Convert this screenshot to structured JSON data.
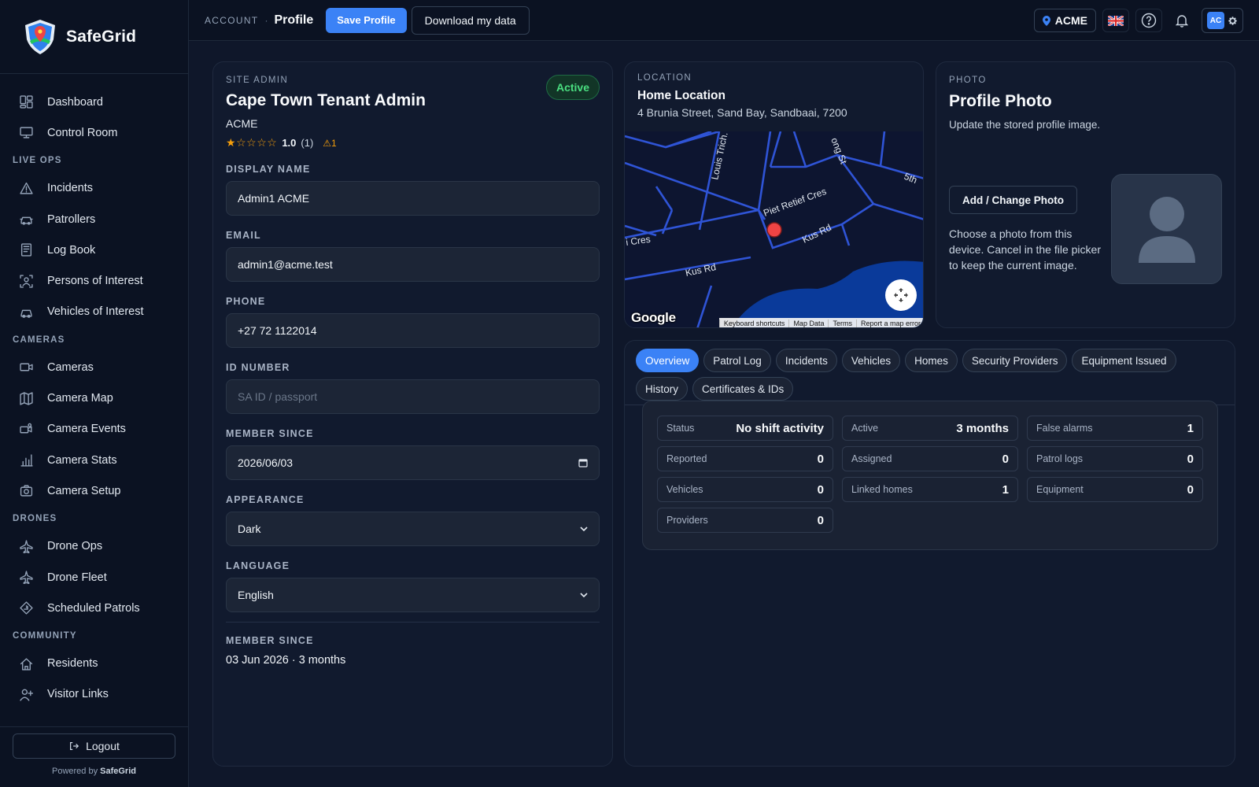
{
  "app": {
    "name": "SafeGrid",
    "powered_prefix": "Powered by",
    "powered_brand": "SafeGrid",
    "logout": "Logout"
  },
  "sidebar": {
    "top": [
      {
        "label": "Dashboard",
        "icon": "dashboard-icon"
      },
      {
        "label": "Control Room",
        "icon": "monitor-icon"
      }
    ],
    "sections": [
      {
        "title": "LIVE OPS",
        "items": [
          {
            "label": "Incidents",
            "icon": "warning-icon"
          },
          {
            "label": "Patrollers",
            "icon": "car-icon"
          },
          {
            "label": "Log Book",
            "icon": "logbook-icon"
          },
          {
            "label": "Persons of Interest",
            "icon": "person-scan-icon"
          },
          {
            "label": "Vehicles of Interest",
            "icon": "vehicle-icon"
          }
        ]
      },
      {
        "title": "CAMERAS",
        "items": [
          {
            "label": "Cameras",
            "icon": "camera-icon"
          },
          {
            "label": "Camera Map",
            "icon": "map-icon"
          },
          {
            "label": "Camera Events",
            "icon": "camera-events-icon"
          },
          {
            "label": "Camera Stats",
            "icon": "bar-chart-icon"
          },
          {
            "label": "Camera Setup",
            "icon": "camera-setup-icon"
          }
        ]
      },
      {
        "title": "DRONES",
        "items": [
          {
            "label": "Drone Ops",
            "icon": "plane-icon"
          },
          {
            "label": "Drone Fleet",
            "icon": "plane-icon"
          },
          {
            "label": "Scheduled Patrols",
            "icon": "route-icon"
          }
        ]
      },
      {
        "title": "COMMUNITY",
        "items": [
          {
            "label": "Residents",
            "icon": "house-icon"
          },
          {
            "label": "Visitor Links",
            "icon": "user-add-icon"
          }
        ]
      }
    ]
  },
  "topbar": {
    "breadcrumb_root": "ACCOUNT",
    "breadcrumb_sep": "·",
    "page_title": "Profile",
    "save_label": "Save Profile",
    "download_label": "Download my data",
    "tenant": "ACME",
    "user_initials": "AC"
  },
  "profile": {
    "role": "SITE ADMIN",
    "name": "Cape Town Tenant Admin",
    "tenant": "ACME",
    "status": "Active",
    "rating_value": "1.0",
    "rating_count": "(1)",
    "rating_stars": 1,
    "warning_count": "1",
    "fields": {
      "display_name": {
        "label": "DISPLAY NAME",
        "value": "Admin1 ACME"
      },
      "email": {
        "label": "EMAIL",
        "value": "admin1@acme.test"
      },
      "phone": {
        "label": "PHONE",
        "value": "+27 72 1122014"
      },
      "id_number": {
        "label": "ID NUMBER",
        "placeholder": "SA ID / passport",
        "value": ""
      },
      "member_since": {
        "label": "MEMBER SINCE",
        "value": "2026/06/03"
      },
      "appearance": {
        "label": "APPEARANCE",
        "value": "Dark"
      },
      "language": {
        "label": "LANGUAGE",
        "value": "English"
      }
    },
    "member_since_label": "MEMBER SINCE",
    "member_since_text": "03 Jun 2026 · 3 months"
  },
  "location": {
    "label": "LOCATION",
    "title": "Home Location",
    "address": "4 Brunia Street, Sand Bay, Sandbaai, 7200",
    "map": {
      "streets": [
        "Louis Trich.",
        "Piet Retief Cres",
        "Kus Rd",
        "Kus Rd",
        "i Cres",
        "ong St",
        "5th"
      ],
      "logo": "Google",
      "footer": [
        "Keyboard shortcuts",
        "Map Data",
        "Terms",
        "Report a map error"
      ]
    }
  },
  "photo": {
    "label": "PHOTO",
    "title": "Profile Photo",
    "subtitle": "Update the stored profile image.",
    "button": "Add / Change Photo",
    "help": "Choose a photo from this device. Cancel in the file picker to keep the current image."
  },
  "tabs": [
    {
      "label": "Overview",
      "active": true
    },
    {
      "label": "Patrol Log"
    },
    {
      "label": "Incidents"
    },
    {
      "label": "Vehicles"
    },
    {
      "label": "Homes"
    },
    {
      "label": "Security Providers"
    },
    {
      "label": "Equipment Issued"
    },
    {
      "label": "History"
    },
    {
      "label": "Certificates & IDs"
    }
  ],
  "overview": {
    "stats": [
      {
        "label": "Status",
        "value": "No shift activity"
      },
      {
        "label": "Active",
        "value": "3 months"
      },
      {
        "label": "False alarms",
        "value": "1"
      },
      {
        "label": "Reported",
        "value": "0"
      },
      {
        "label": "Assigned",
        "value": "0"
      },
      {
        "label": "Patrol logs",
        "value": "0"
      },
      {
        "label": "Vehicles",
        "value": "0"
      },
      {
        "label": "Linked homes",
        "value": "1"
      },
      {
        "label": "Equipment",
        "value": "0"
      },
      {
        "label": "Providers",
        "value": "0"
      }
    ]
  },
  "colors": {
    "accent": "#3b82f6",
    "success": "#4ade80",
    "warning": "#f59e0b",
    "map_pin": "#ef4444"
  }
}
